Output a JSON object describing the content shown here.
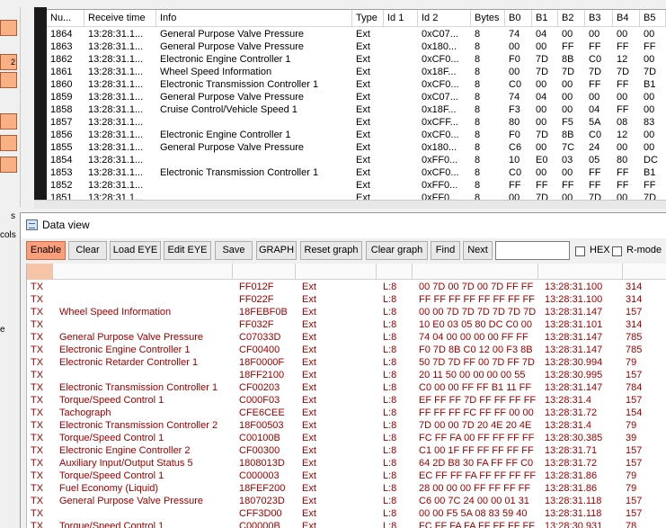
{
  "left_buttons": [
    "",
    "2",
    "",
    "",
    "",
    ""
  ],
  "left_fragments": [
    "s",
    "cols",
    "e"
  ],
  "message_table": {
    "columns": [
      "Nu...",
      "Receive time",
      "Info",
      "Type",
      "Id 1",
      "Id 2",
      "Bytes",
      "B0",
      "B1",
      "B2",
      "B3",
      "B4",
      "B5"
    ],
    "rows": [
      [
        "1864",
        "13:28:31.1...",
        "General Purpose Valve Pressure",
        "Ext",
        "",
        "0xC07...",
        "8",
        "74",
        "04",
        "00",
        "00",
        "00",
        "00"
      ],
      [
        "1863",
        "13:28:31.1...",
        "General Purpose Valve Pressure",
        "Ext",
        "",
        "0x180...",
        "8",
        "00",
        "00",
        "FF",
        "FF",
        "FF",
        "FF"
      ],
      [
        "1862",
        "13:28:31.1...",
        "Electronic Engine Controller 1",
        "Ext",
        "",
        "0xCF0...",
        "8",
        "F0",
        "7D",
        "8B",
        "C0",
        "12",
        "00"
      ],
      [
        "1861",
        "13:28:31.1...",
        "Wheel Speed Information",
        "Ext",
        "",
        "0x18F...",
        "8",
        "00",
        "7D",
        "7D",
        "7D",
        "7D",
        "7D"
      ],
      [
        "1860",
        "13:28:31.1...",
        "Electronic Transmission Controller 1",
        "Ext",
        "",
        "0xCF0...",
        "8",
        "C0",
        "00",
        "00",
        "FF",
        "FF",
        "B1"
      ],
      [
        "1859",
        "13:28:31.1...",
        "General Purpose Valve Pressure",
        "Ext",
        "",
        "0xC07...",
        "8",
        "74",
        "04",
        "00",
        "00",
        "00",
        "00"
      ],
      [
        "1858",
        "13:28:31.1...",
        "Cruise Control/Vehicle Speed 1",
        "Ext",
        "",
        "0x18F...",
        "8",
        "F3",
        "00",
        "00",
        "04",
        "FF",
        "00"
      ],
      [
        "1857",
        "13:28:31.1...",
        "",
        "Ext",
        "",
        "0xCFF...",
        "8",
        "80",
        "00",
        "F5",
        "5A",
        "08",
        "83"
      ],
      [
        "1856",
        "13:28:31.1...",
        "Electronic Engine Controller 1",
        "Ext",
        "",
        "0xCF0...",
        "8",
        "F0",
        "7D",
        "8B",
        "C0",
        "12",
        "00"
      ],
      [
        "1855",
        "13:28:31.1...",
        "General Purpose Valve Pressure",
        "Ext",
        "",
        "0x180...",
        "8",
        "C6",
        "00",
        "7C",
        "24",
        "00",
        "00"
      ],
      [
        "1854",
        "13:28:31.1...",
        "",
        "Ext",
        "",
        "0xFF0...",
        "8",
        "10",
        "E0",
        "03",
        "05",
        "80",
        "DC"
      ],
      [
        "1853",
        "13:28:31.1...",
        "Electronic Transmission Controller 1",
        "Ext",
        "",
        "0xCF0...",
        "8",
        "C0",
        "00",
        "00",
        "FF",
        "FF",
        "B1"
      ],
      [
        "1852",
        "13:28:31.1...",
        "",
        "Ext",
        "",
        "0xFF0...",
        "8",
        "FF",
        "FF",
        "FF",
        "FF",
        "FF",
        "FF"
      ],
      [
        "1851",
        "13:28:31.1...",
        "",
        "Ext",
        "",
        "0xFF0...",
        "8",
        "00",
        "7D",
        "00",
        "7D",
        "00",
        "7D"
      ]
    ]
  },
  "data_view": {
    "title": "Data view",
    "toolbar": {
      "enable": "Enable",
      "clear": "Clear",
      "load_eye": "Load EYE",
      "edit_eye": "Edit EYE",
      "save": "Save",
      "graph": "GRAPH",
      "reset_graph": "Reset graph",
      "clear_graph": "Clear graph",
      "find": "Find",
      "next": "Next",
      "find_value": "",
      "hex_label": "HEX",
      "rmode_label": "R-mode"
    },
    "rows": [
      [
        "TX",
        "",
        "FF012F",
        "Ext",
        "L:8",
        "00 7D 00 7D 00 7D FF FF",
        "13:28:31.100",
        "314"
      ],
      [
        "TX",
        "",
        "FF022F",
        "Ext",
        "L:8",
        "FF FF FF FF FF FF FF FF",
        "13:28:31.100",
        "314"
      ],
      [
        "TX",
        "Wheel Speed Information",
        "18FEBF0B",
        "Ext",
        "L:8",
        "00 00 7D 7D 7D 7D 7D 7D",
        "13:28:31.147",
        "157"
      ],
      [
        "TX",
        "",
        "FF032F",
        "Ext",
        "L:8",
        "10 E0 03 05 80 DC C0 00",
        "13:28:31.101",
        "314"
      ],
      [
        "TX",
        "General Purpose Valve Pressure",
        "C07033D",
        "Ext",
        "L:8",
        "74 04 00 00 00 00 FF FF",
        "13:28:31.147",
        "785"
      ],
      [
        "TX",
        "Electronic Engine Controller 1",
        "CF00400",
        "Ext",
        "L:8",
        "F0 7D 8B C0 12 00 F3 8B",
        "13:28:31.147",
        "785"
      ],
      [
        "TX",
        "Electronic Retarder Controller 1",
        "18F0000F",
        "Ext",
        "L:8",
        "50 7D 7D FF 00 7D FF 7D",
        "13:28:30.994",
        "79"
      ],
      [
        "TX",
        "",
        "18FF2100",
        "Ext",
        "L:8",
        "20 11 50 00 00 00 00 55",
        "13:28:30.995",
        "157"
      ],
      [
        "TX",
        "Electronic Transmission Controller 1",
        "CF00203",
        "Ext",
        "L:8",
        "C0 00 00 FF FF B1 11 FF",
        "13:28:31.147",
        "784"
      ],
      [
        "TX",
        "Torque/Speed Control 1",
        "C000F03",
        "Ext",
        "L:8",
        "EF FF FF 7D FF FF FF FF",
        "13:28:31.4",
        "157"
      ],
      [
        "TX",
        "Tachograph",
        "CFE6CEE",
        "Ext",
        "L:8",
        "FF FF FF FC FF FF 00 00",
        "13:28:31.72",
        "154"
      ],
      [
        "TX",
        "Electronic Transmission Controller 2",
        "18F00503",
        "Ext",
        "L:8",
        "7D 00 00 7D 20 4E 20 4E",
        "13:28:31.4",
        "79"
      ],
      [
        "TX",
        "Torque/Speed Control 1",
        "C00100B",
        "Ext",
        "L:8",
        "FC FF FA 00 FF FF FF FF",
        "13:28:30.385",
        "39"
      ],
      [
        "TX",
        "Electronic Engine Controller 2",
        "CF00300",
        "Ext",
        "L:8",
        "C1 00 1F FF FF FF FF FF",
        "13:28:31.71",
        "157"
      ],
      [
        "TX",
        "Auxiliary Input/Output Status 5",
        "1808013D",
        "Ext",
        "L:8",
        "64 2D B8 30 FA FF FF C0",
        "13:28:31.72",
        "157"
      ],
      [
        "TX",
        "Torque/Speed Control 1",
        "C000003",
        "Ext",
        "L:8",
        "EC FF FF FA FF FF FF FF",
        "13:28:31.86",
        "79"
      ],
      [
        "TX",
        "Fuel Economy (Liquid)",
        "18FEF200",
        "Ext",
        "L:8",
        "28 00 00 00 FF FF FF FF",
        "13:28:31.86",
        "79"
      ],
      [
        "TX",
        "General Purpose Valve Pressure",
        "1807023D",
        "Ext",
        "L:8",
        "C6 00 7C 24 00 00 01 31",
        "13:28:31.118",
        "157"
      ],
      [
        "TX",
        "",
        "CFF3D00",
        "Ext",
        "L:8",
        "00 00 F5 5A 08 83 59 40",
        "13:28:31.118",
        "157"
      ],
      [
        "TX",
        "Torque/Speed Control 1",
        "C00000B",
        "Ext",
        "L:8",
        "FC FF FA FA FF FF FF FF",
        "13:28:30.931",
        "78"
      ]
    ]
  }
}
